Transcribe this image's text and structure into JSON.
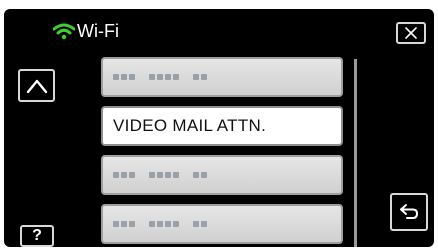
{
  "header": {
    "title": "Wi-Fi",
    "icon": "wifi-icon",
    "icon_color": "#3bd12f"
  },
  "buttons": {
    "close_icon": "close-icon",
    "up_icon": "chevron-up-icon",
    "help_label": "?",
    "back_icon": "back-arrow-icon"
  },
  "list": {
    "items": [
      {
        "label": "",
        "masked": true,
        "selected": false
      },
      {
        "label": "VIDEO MAIL ATTN.",
        "masked": false,
        "selected": true
      },
      {
        "label": "",
        "masked": true,
        "selected": false
      },
      {
        "label": "",
        "masked": true,
        "selected": false
      }
    ]
  }
}
